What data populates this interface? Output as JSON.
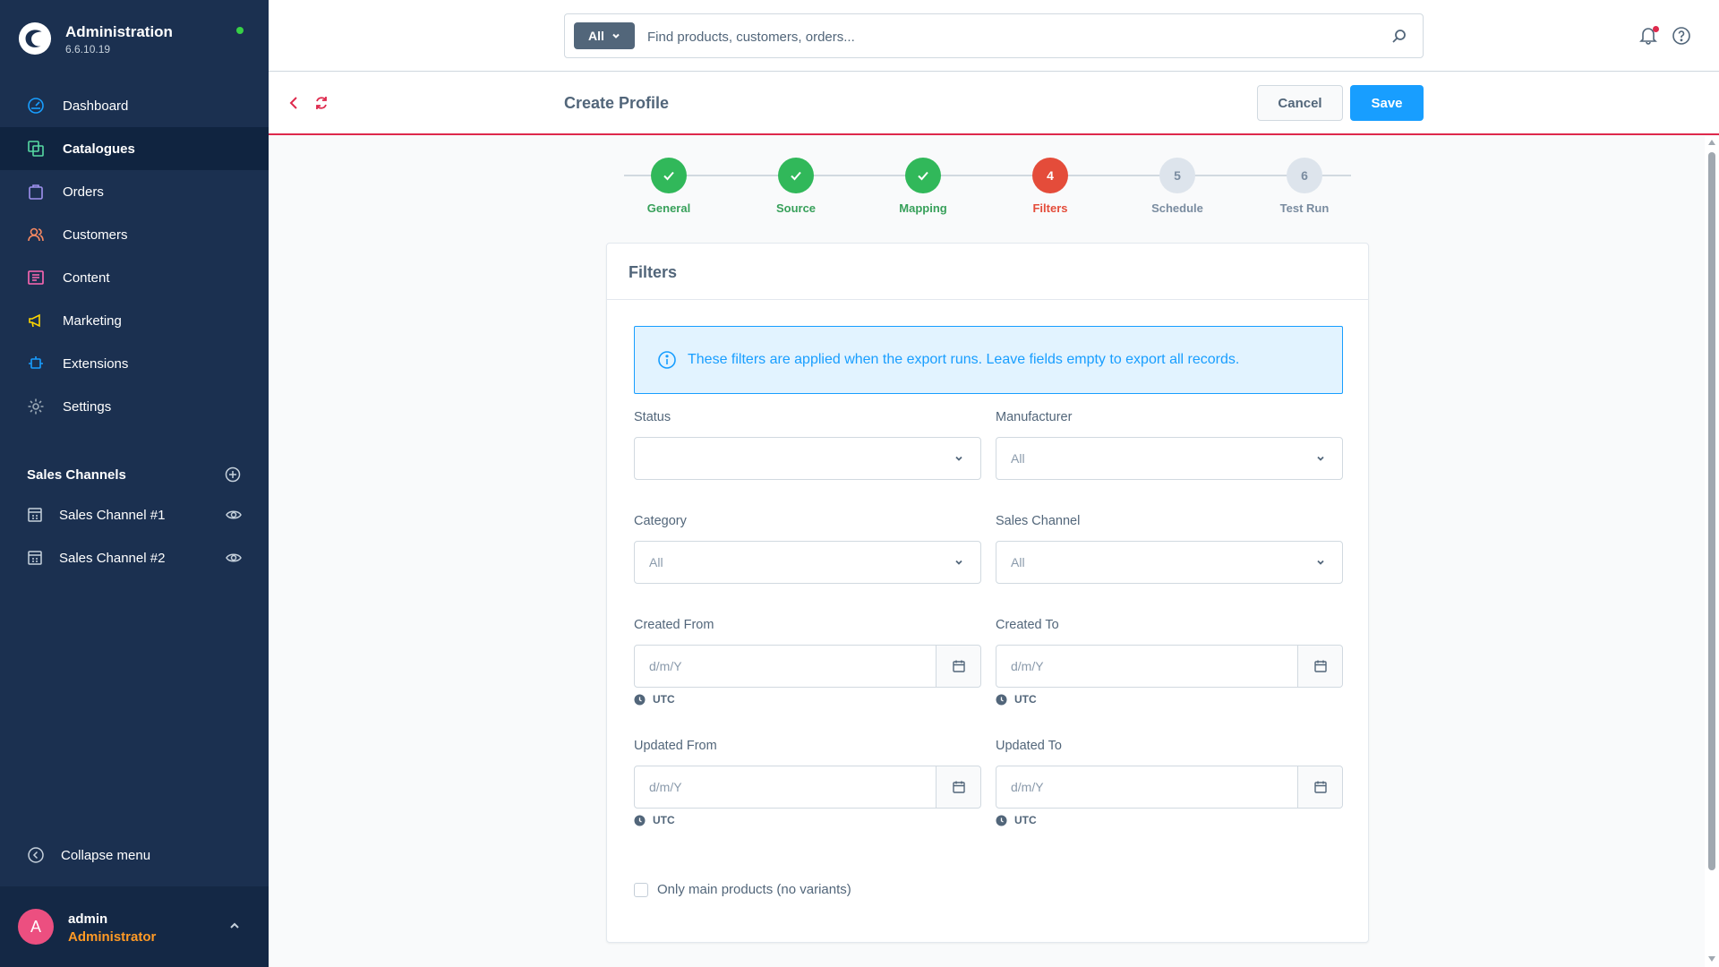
{
  "app": {
    "title": "Administration",
    "version": "6.6.10.19",
    "status_color": "#37d046"
  },
  "sidebar": {
    "items": [
      {
        "label": "Dashboard",
        "icon": "dashboard-icon",
        "color": "#189eff",
        "active": false
      },
      {
        "label": "Catalogues",
        "icon": "catalogues-icon",
        "color": "#57d9a3",
        "active": true
      },
      {
        "label": "Orders",
        "icon": "orders-icon",
        "color": "#a092f0",
        "active": false
      },
      {
        "label": "Customers",
        "icon": "customers-icon",
        "color": "#f88962",
        "active": false
      },
      {
        "label": "Content",
        "icon": "content-icon",
        "color": "#ff68b4",
        "active": false
      },
      {
        "label": "Marketing",
        "icon": "marketing-icon",
        "color": "#ffd700",
        "active": false
      },
      {
        "label": "Extensions",
        "icon": "extensions-icon",
        "color": "#189eff",
        "active": false
      },
      {
        "label": "Settings",
        "icon": "settings-icon",
        "color": "#9aa8b5",
        "active": false
      }
    ],
    "sales_channels": {
      "title": "Sales Channels",
      "items": [
        {
          "label": "Sales Channel #1"
        },
        {
          "label": "Sales Channel #2"
        }
      ]
    },
    "collapse_label": "Collapse menu"
  },
  "user": {
    "initial": "A",
    "name": "admin",
    "role": "Administrator"
  },
  "search": {
    "type_label": "All",
    "placeholder": "Find products, customers, orders..."
  },
  "smartbar": {
    "title": "Create Profile",
    "cancel_label": "Cancel",
    "save_label": "Save"
  },
  "stepper": {
    "steps": [
      {
        "number": "1",
        "label": "General",
        "state": "done"
      },
      {
        "number": "2",
        "label": "Source",
        "state": "done"
      },
      {
        "number": "3",
        "label": "Mapping",
        "state": "done"
      },
      {
        "number": "4",
        "label": "Filters",
        "state": "current"
      },
      {
        "number": "5",
        "label": "Schedule",
        "state": "todo"
      },
      {
        "number": "6",
        "label": "Test Run",
        "state": "todo"
      }
    ]
  },
  "card": {
    "title": "Filters",
    "alert": "These filters are applied when the export runs. Leave fields empty to export all records.",
    "status": {
      "label": "Status",
      "value": ""
    },
    "manufacturer": {
      "label": "Manufacturer",
      "value": "All"
    },
    "category": {
      "label": "Category",
      "value": "All"
    },
    "sales_channel": {
      "label": "Sales Channel",
      "value": "All"
    },
    "created_from": {
      "label": "Created From",
      "placeholder": "d/m/Y",
      "timezone": "UTC"
    },
    "created_to": {
      "label": "Created To",
      "placeholder": "d/m/Y",
      "timezone": "UTC"
    },
    "updated_from": {
      "label": "Updated From",
      "placeholder": "d/m/Y",
      "timezone": "UTC"
    },
    "updated_to": {
      "label": "Updated To",
      "placeholder": "d/m/Y",
      "timezone": "UTC"
    },
    "main_products_label": "Only main products (no variants)"
  }
}
